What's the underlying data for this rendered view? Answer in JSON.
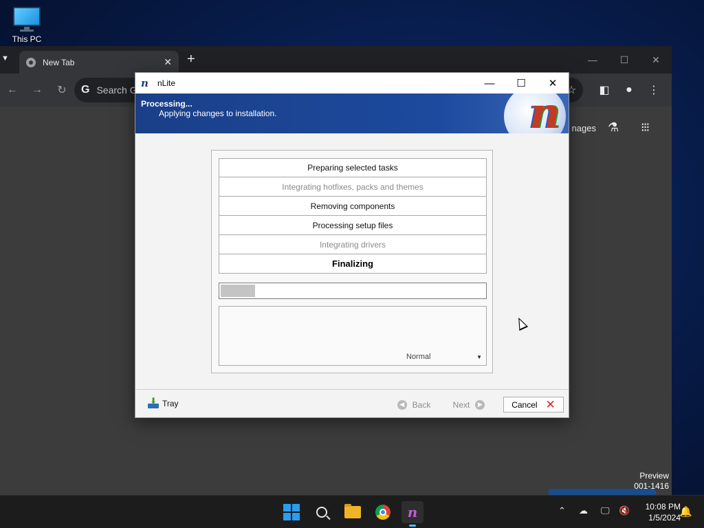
{
  "desktop": {
    "icon_label": "This PC"
  },
  "browser": {
    "tab_title": "New Tab",
    "tab_close": "✕",
    "new_tab": "+",
    "omnibox_text": "Search G",
    "page_links": "nages",
    "watermark_line1": "Preview",
    "watermark_line2": "001-1416"
  },
  "dialog": {
    "title": "nLite",
    "banner_heading": "Processing...",
    "banner_subtitle": "Applying changes to installation.",
    "steps": [
      {
        "label": "Preparing selected tasks",
        "state": "done"
      },
      {
        "label": "Integrating hotfixes, packs and themes",
        "state": "skipped"
      },
      {
        "label": "Removing components",
        "state": "done"
      },
      {
        "label": "Processing setup files",
        "state": "done"
      },
      {
        "label": "Integrating drivers",
        "state": "skipped"
      },
      {
        "label": "Finalizing",
        "state": "current"
      }
    ],
    "progress_percent": 13,
    "priority_value": "Normal",
    "footer": {
      "tray_label": "Tray",
      "back_label": "Back",
      "next_label": "Next",
      "cancel_label": "Cancel"
    }
  },
  "taskbar": {
    "time": "10:08 PM",
    "date": "1/5/2024"
  },
  "colors": {
    "banner_blue": "#1a3f88",
    "accent_blue": "#4cc2ff",
    "cancel_red": "#dd2222"
  }
}
